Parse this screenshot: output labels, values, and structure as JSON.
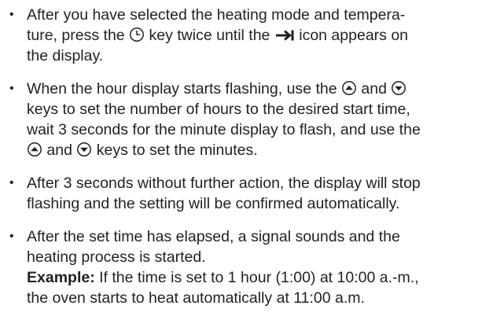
{
  "bullets": [
    {
      "lines": [
        [
          "After you have selected the heating mode and tempera-"
        ],
        [
          "ture, press the ",
          "#clock",
          " key twice until the ",
          "#arrow",
          " icon appears on"
        ],
        [
          "the display."
        ]
      ]
    },
    {
      "lines": [
        [
          "When the hour display starts flashing, use the ",
          "#up",
          " and ",
          "#down"
        ],
        [
          "keys to set the number of hours to the desired start time,"
        ],
        [
          "wait 3 seconds for the minute display to flash, and use the"
        ],
        [
          "#up",
          " and ",
          "#down",
          " keys to set the minutes."
        ]
      ]
    },
    {
      "lines": [
        [
          "After 3 seconds without further action, the display will stop"
        ],
        [
          "flashing and the setting will be confirmed automatically."
        ]
      ]
    },
    {
      "lines": [
        [
          "After the set time has elapsed, a signal sounds and the"
        ],
        [
          "heating process is started."
        ],
        [
          "**Example:",
          " If the time is set to 1 hour (1:00) at 10:00 a.-m.,"
        ],
        [
          "the oven starts to heat automatically at 11:00 a.m."
        ]
      ]
    }
  ],
  "icons": {
    "clock": "clock-key-icon",
    "arrow": "arrow-to-bar-icon",
    "up": "up-key-icon",
    "down": "down-key-icon"
  },
  "bullet_char": "•",
  "colors": {
    "text": "#222222",
    "background": "#ffffff"
  }
}
